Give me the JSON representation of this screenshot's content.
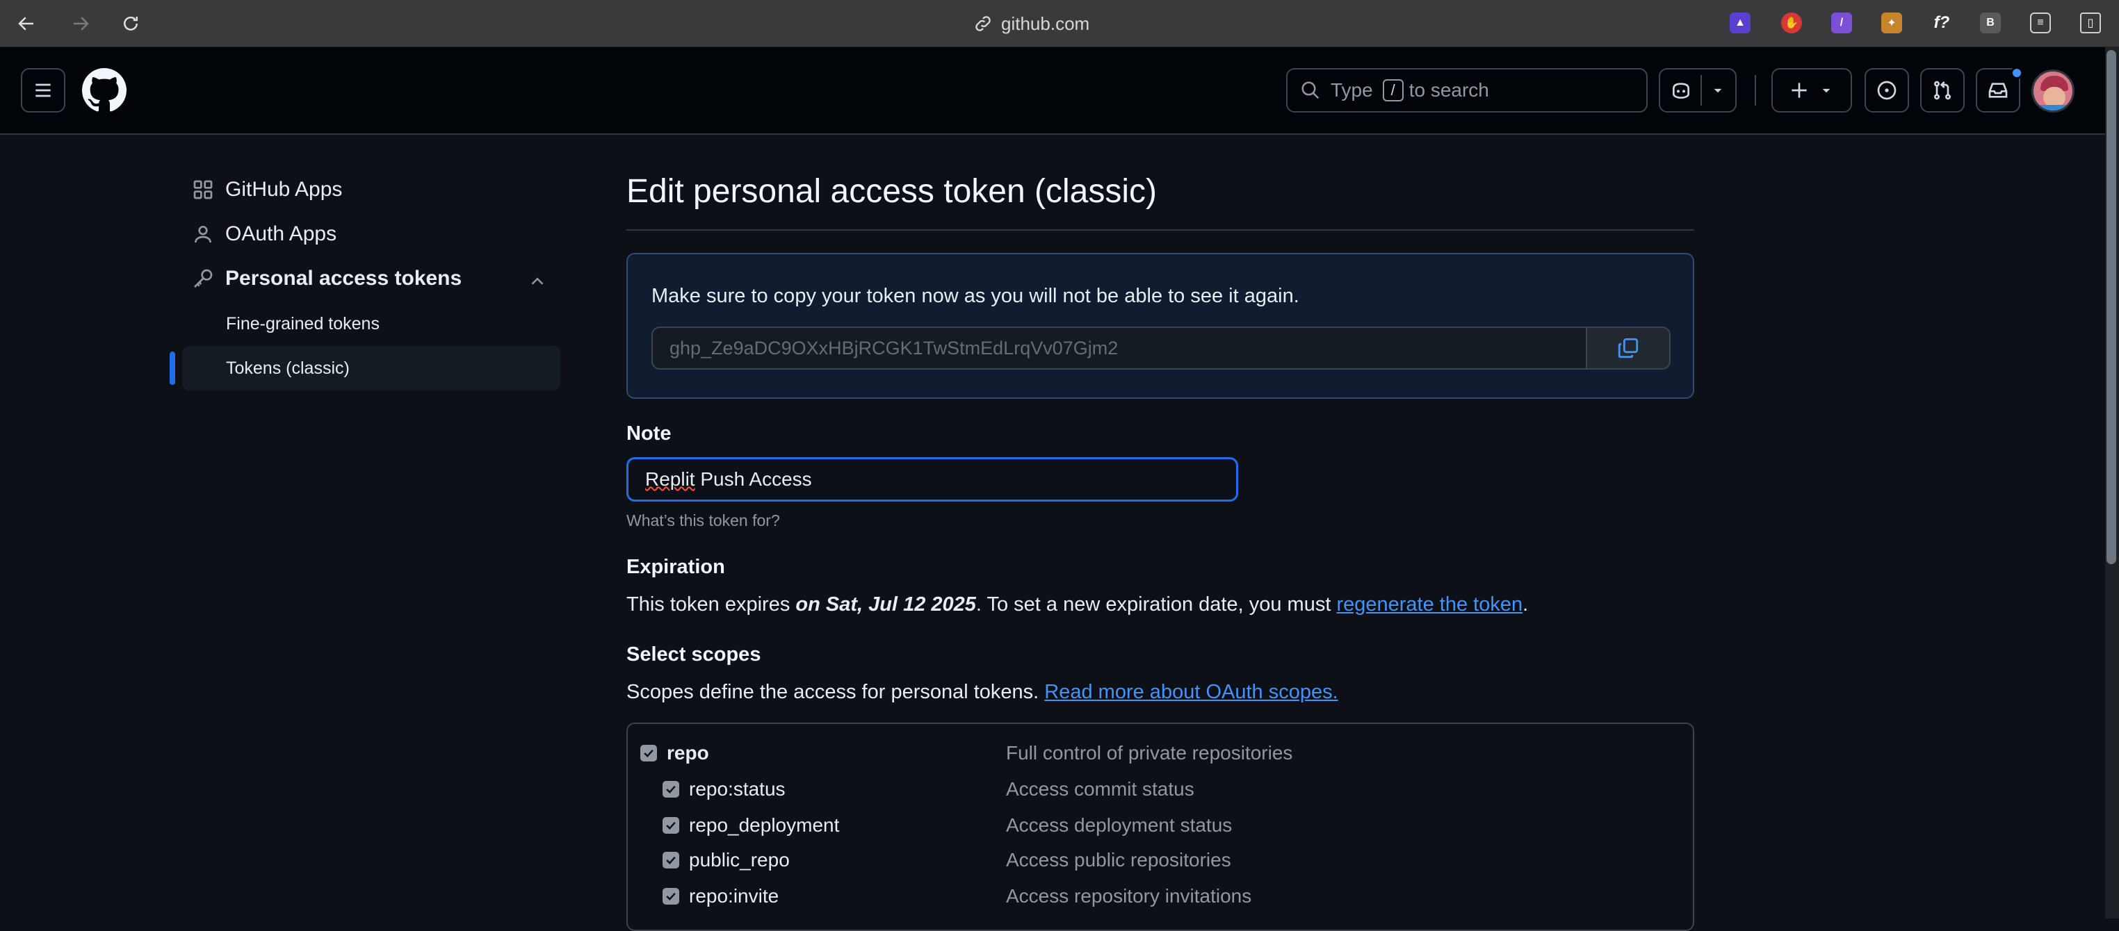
{
  "browser": {
    "url": "github.com",
    "extension_letter": "B",
    "extension_f": "f?"
  },
  "header": {
    "search_prefix": "Type",
    "search_key": "/",
    "search_suffix": "to search"
  },
  "sidebar": {
    "items": [
      {
        "label": "GitHub Apps",
        "icon": "apps-icon"
      },
      {
        "label": "OAuth Apps",
        "icon": "person-icon"
      },
      {
        "label": "Personal access tokens",
        "icon": "key-icon"
      }
    ],
    "sub_items": [
      {
        "label": "Fine-grained tokens"
      },
      {
        "label": "Tokens (classic)"
      }
    ]
  },
  "main": {
    "title": "Edit personal access token (classic)",
    "flash_message": "Make sure to copy your token now as you will not be able to see it again.",
    "token_value": "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",
    "note_label": "Note",
    "note_value_word1": "Replit",
    "note_value_rest": " Push Access",
    "note_hint": "What’s this token for?",
    "expiration_label": "Expiration",
    "expiration_pre": "This token expires ",
    "expiration_date": "on Sat, Jul 12 2025",
    "expiration_mid": ". To set a new expiration date, you must ",
    "expiration_link": "regenerate the token",
    "expiration_end": ".",
    "scopes_label": "Select scopes",
    "scopes_desc": "Scopes define the access for personal tokens. ",
    "scopes_link": "Read more about OAuth scopes.",
    "scopes": [
      {
        "name": "repo",
        "desc": "Full control of private repositories",
        "checked": true
      },
      {
        "name": "repo:status",
        "desc": "Access commit status",
        "checked": true
      },
      {
        "name": "repo_deployment",
        "desc": "Access deployment status",
        "checked": true
      },
      {
        "name": "public_repo",
        "desc": "Access public repositories",
        "checked": true
      },
      {
        "name": "repo:invite",
        "desc": "Access repository invitations",
        "checked": true
      }
    ]
  },
  "colors": {
    "accent": "#1f6feb",
    "link": "#4493f8",
    "background": "#0d1117"
  }
}
